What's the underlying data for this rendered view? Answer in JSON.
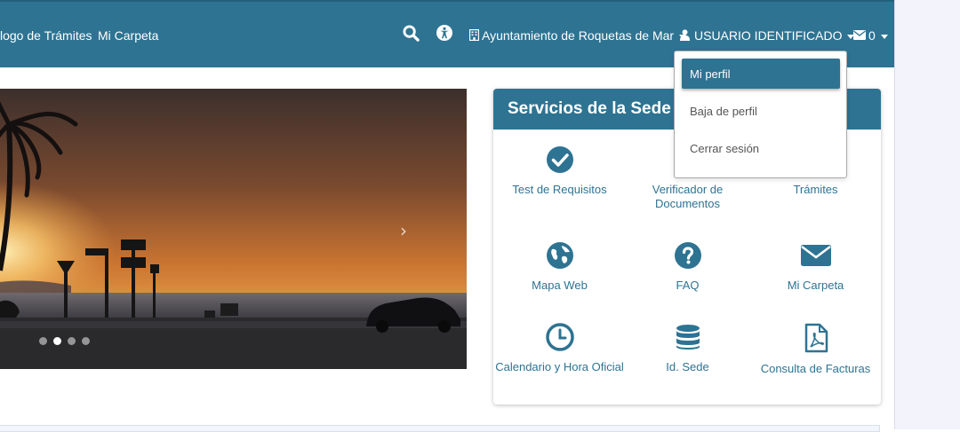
{
  "nav": {
    "links": [
      {
        "label": "logo de Trámites"
      },
      {
        "label": "Mi Carpeta"
      }
    ],
    "organization_label": "Ayuntamiento de Roquetas de Mar",
    "user_label": "USUARIO IDENTIFICADO",
    "mail_count": "0",
    "icons": [
      "search-icon",
      "accessibility-icon",
      "building-icon",
      "user-icon",
      "envelope-icon"
    ]
  },
  "user_menu": {
    "items": [
      {
        "label": "Mi perfil",
        "active": true
      },
      {
        "label": "Baja de perfil",
        "active": false
      },
      {
        "label": "Cerrar sesión",
        "active": false
      }
    ]
  },
  "carousel": {
    "slide_count": 4,
    "active_slide": 2,
    "next_icon": "chevron-right-icon"
  },
  "services": {
    "title": "Servicios de la Sede E",
    "items": [
      {
        "label": "Test de Requisitos",
        "icon": "check-circle-icon"
      },
      {
        "label": "Verificador de Documentos",
        "icon": "document-icon"
      },
      {
        "label": "Trámites",
        "icon": "tramites-icon"
      },
      {
        "label": "Mapa Web",
        "icon": "globe-icon"
      },
      {
        "label": "FAQ",
        "icon": "question-circle-icon"
      },
      {
        "label": "Mi Carpeta",
        "icon": "envelope-icon"
      },
      {
        "label": "Calendario y Hora Oficial",
        "icon": "clock-icon"
      },
      {
        "label": "Id. Sede",
        "icon": "database-icon"
      },
      {
        "label": "Consulta de Facturas",
        "icon": "pdf-file-icon"
      }
    ]
  },
  "colors": {
    "brand": "#2e7392",
    "background": "#ffffff"
  }
}
